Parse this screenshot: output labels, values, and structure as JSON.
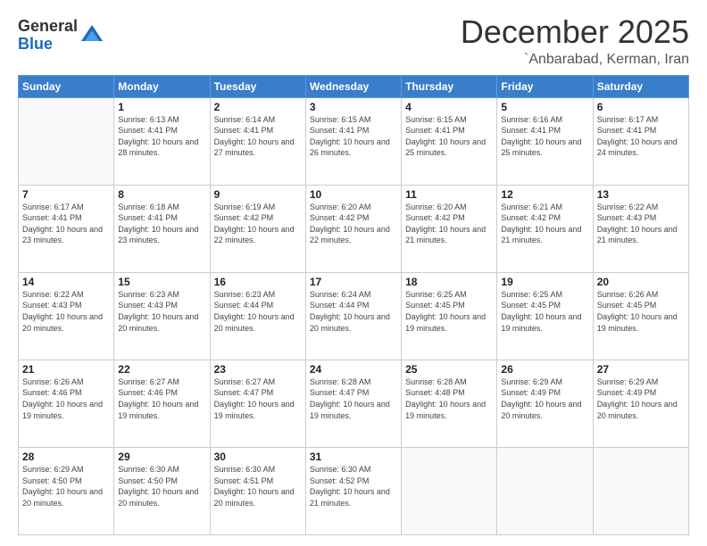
{
  "logo": {
    "general": "General",
    "blue": "Blue"
  },
  "header": {
    "month": "December 2025",
    "location": "`Anbarabad, Kerman, Iran"
  },
  "days_of_week": [
    "Sunday",
    "Monday",
    "Tuesday",
    "Wednesday",
    "Thursday",
    "Friday",
    "Saturday"
  ],
  "weeks": [
    [
      {
        "day": "",
        "sunrise": "",
        "sunset": "",
        "daylight": ""
      },
      {
        "day": "1",
        "sunrise": "6:13 AM",
        "sunset": "4:41 PM",
        "daylight": "10 hours and 28 minutes."
      },
      {
        "day": "2",
        "sunrise": "6:14 AM",
        "sunset": "4:41 PM",
        "daylight": "10 hours and 27 minutes."
      },
      {
        "day": "3",
        "sunrise": "6:15 AM",
        "sunset": "4:41 PM",
        "daylight": "10 hours and 26 minutes."
      },
      {
        "day": "4",
        "sunrise": "6:15 AM",
        "sunset": "4:41 PM",
        "daylight": "10 hours and 25 minutes."
      },
      {
        "day": "5",
        "sunrise": "6:16 AM",
        "sunset": "4:41 PM",
        "daylight": "10 hours and 25 minutes."
      },
      {
        "day": "6",
        "sunrise": "6:17 AM",
        "sunset": "4:41 PM",
        "daylight": "10 hours and 24 minutes."
      }
    ],
    [
      {
        "day": "7",
        "sunrise": "6:17 AM",
        "sunset": "4:41 PM",
        "daylight": "10 hours and 23 minutes."
      },
      {
        "day": "8",
        "sunrise": "6:18 AM",
        "sunset": "4:41 PM",
        "daylight": "10 hours and 23 minutes."
      },
      {
        "day": "9",
        "sunrise": "6:19 AM",
        "sunset": "4:42 PM",
        "daylight": "10 hours and 22 minutes."
      },
      {
        "day": "10",
        "sunrise": "6:20 AM",
        "sunset": "4:42 PM",
        "daylight": "10 hours and 22 minutes."
      },
      {
        "day": "11",
        "sunrise": "6:20 AM",
        "sunset": "4:42 PM",
        "daylight": "10 hours and 21 minutes."
      },
      {
        "day": "12",
        "sunrise": "6:21 AM",
        "sunset": "4:42 PM",
        "daylight": "10 hours and 21 minutes."
      },
      {
        "day": "13",
        "sunrise": "6:22 AM",
        "sunset": "4:43 PM",
        "daylight": "10 hours and 21 minutes."
      }
    ],
    [
      {
        "day": "14",
        "sunrise": "6:22 AM",
        "sunset": "4:43 PM",
        "daylight": "10 hours and 20 minutes."
      },
      {
        "day": "15",
        "sunrise": "6:23 AM",
        "sunset": "4:43 PM",
        "daylight": "10 hours and 20 minutes."
      },
      {
        "day": "16",
        "sunrise": "6:23 AM",
        "sunset": "4:44 PM",
        "daylight": "10 hours and 20 minutes."
      },
      {
        "day": "17",
        "sunrise": "6:24 AM",
        "sunset": "4:44 PM",
        "daylight": "10 hours and 20 minutes."
      },
      {
        "day": "18",
        "sunrise": "6:25 AM",
        "sunset": "4:45 PM",
        "daylight": "10 hours and 19 minutes."
      },
      {
        "day": "19",
        "sunrise": "6:25 AM",
        "sunset": "4:45 PM",
        "daylight": "10 hours and 19 minutes."
      },
      {
        "day": "20",
        "sunrise": "6:26 AM",
        "sunset": "4:45 PM",
        "daylight": "10 hours and 19 minutes."
      }
    ],
    [
      {
        "day": "21",
        "sunrise": "6:26 AM",
        "sunset": "4:46 PM",
        "daylight": "10 hours and 19 minutes."
      },
      {
        "day": "22",
        "sunrise": "6:27 AM",
        "sunset": "4:46 PM",
        "daylight": "10 hours and 19 minutes."
      },
      {
        "day": "23",
        "sunrise": "6:27 AM",
        "sunset": "4:47 PM",
        "daylight": "10 hours and 19 minutes."
      },
      {
        "day": "24",
        "sunrise": "6:28 AM",
        "sunset": "4:47 PM",
        "daylight": "10 hours and 19 minutes."
      },
      {
        "day": "25",
        "sunrise": "6:28 AM",
        "sunset": "4:48 PM",
        "daylight": "10 hours and 19 minutes."
      },
      {
        "day": "26",
        "sunrise": "6:29 AM",
        "sunset": "4:49 PM",
        "daylight": "10 hours and 20 minutes."
      },
      {
        "day": "27",
        "sunrise": "6:29 AM",
        "sunset": "4:49 PM",
        "daylight": "10 hours and 20 minutes."
      }
    ],
    [
      {
        "day": "28",
        "sunrise": "6:29 AM",
        "sunset": "4:50 PM",
        "daylight": "10 hours and 20 minutes."
      },
      {
        "day": "29",
        "sunrise": "6:30 AM",
        "sunset": "4:50 PM",
        "daylight": "10 hours and 20 minutes."
      },
      {
        "day": "30",
        "sunrise": "6:30 AM",
        "sunset": "4:51 PM",
        "daylight": "10 hours and 20 minutes."
      },
      {
        "day": "31",
        "sunrise": "6:30 AM",
        "sunset": "4:52 PM",
        "daylight": "10 hours and 21 minutes."
      },
      {
        "day": "",
        "sunrise": "",
        "sunset": "",
        "daylight": ""
      },
      {
        "day": "",
        "sunrise": "",
        "sunset": "",
        "daylight": ""
      },
      {
        "day": "",
        "sunrise": "",
        "sunset": "",
        "daylight": ""
      }
    ]
  ],
  "labels": {
    "sunrise": "Sunrise:",
    "sunset": "Sunset:",
    "daylight": "Daylight:"
  }
}
